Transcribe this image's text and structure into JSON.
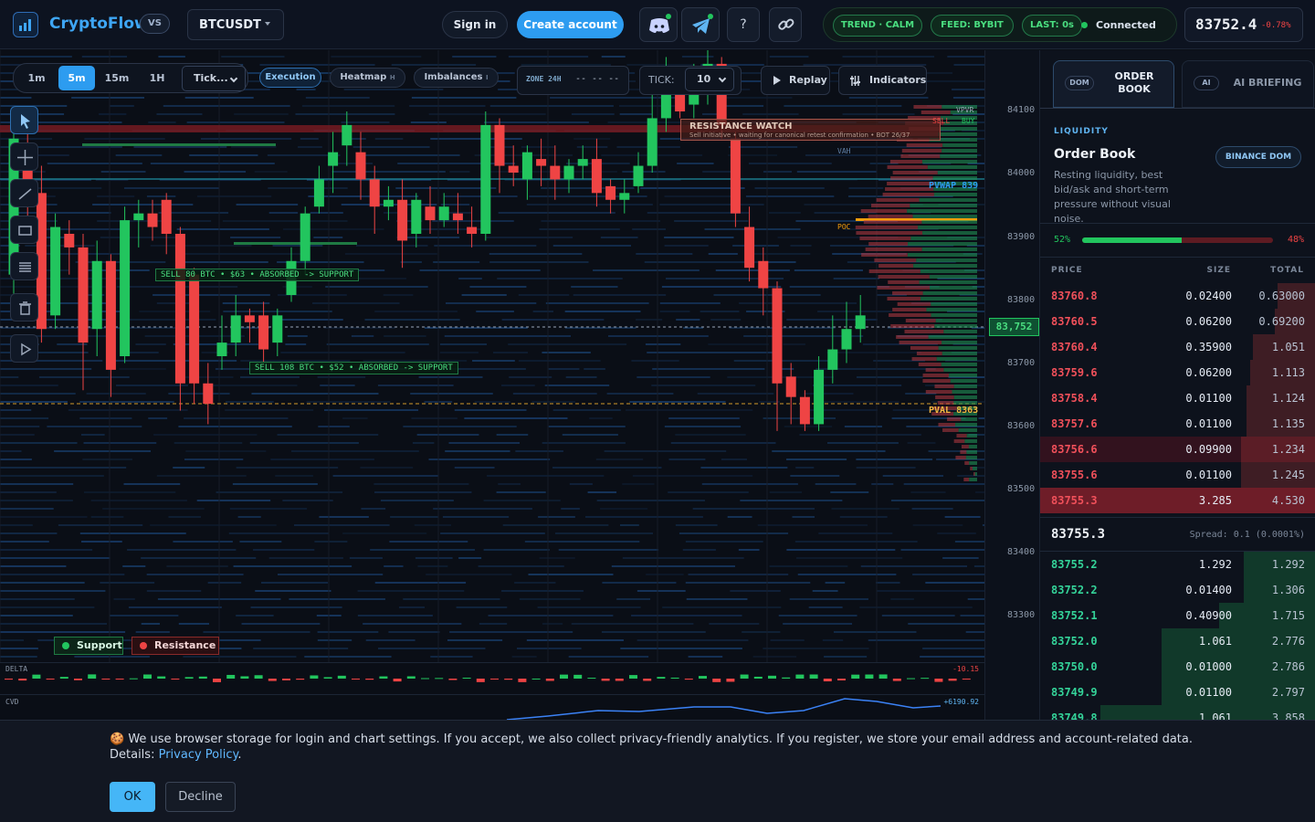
{
  "header": {
    "brand": "CryptoFlow",
    "vs_label": "VS",
    "symbol": "BTCUSDT",
    "sign_in": "Sign in",
    "create_account": "Create account",
    "help_label": "?",
    "status": {
      "trend": "TREND · CALM",
      "feed": "FEED: BYBIT",
      "last": "LAST: 0s",
      "connection": "Connected"
    },
    "price": "83752.4",
    "change": "-0.78%",
    "icons": [
      "discord-icon",
      "telegram-icon",
      "help-icon",
      "link-icon"
    ]
  },
  "toolbar": {
    "timeframes": [
      "1m",
      "5m",
      "15m",
      "1H"
    ],
    "active_timeframe": "5m",
    "type_select": "Tick...",
    "chips": {
      "execution": "Execution",
      "heatmap": "Heatmap",
      "heatmap_key": "H",
      "imbalances": "Imbalances",
      "imbalances_key": "I"
    },
    "zone": {
      "label": "ZONE 24H",
      "value": "-- -- --"
    },
    "tick": {
      "label": "TICK:",
      "value": "10"
    },
    "replay": "Replay",
    "indicators": "Indicators"
  },
  "chart": {
    "resistance_title": "RESISTANCE WATCH",
    "resistance_sub": "Sell initiative • waiting for canonical retest confirmation • BOT 26/37",
    "labels": {
      "absorb1": "SELL 80 BTC • $63 • ABSORBED -> SUPPORT",
      "absorb2": "SELL 108 BTC • $52 • ABSORBED -> SUPPORT",
      "vpvr": "VPVR",
      "sell": "SELL",
      "buy": "BUY",
      "vah": "VAH",
      "pvwap": "PVWAP 839",
      "poc": "POC",
      "pval": "PVAL 8363"
    },
    "legend": {
      "support": "Support",
      "resistance": "Resistance"
    },
    "axis_ticks": [
      "84100",
      "84000",
      "83900",
      "83800",
      "83700",
      "83600",
      "83500",
      "83400",
      "83300"
    ],
    "current_price_tag": "83,752",
    "delta_label": "DELTA",
    "delta_value": "-10.15",
    "cvd_label": "CVD",
    "cvd_value": "+6190.92",
    "colors": {
      "up": "#22c55e",
      "down": "#ef4444",
      "accent": "#2d9cf0"
    }
  },
  "chart_data": {
    "type": "candlestick",
    "ylim": [
      83250,
      84150
    ],
    "candles": [
      [
        83820,
        84020,
        84040,
        83780
      ],
      [
        84010,
        83950,
        84060,
        83900
      ],
      [
        83940,
        83740,
        83980,
        83720
      ],
      [
        83760,
        83890,
        83910,
        83740
      ],
      [
        83880,
        83860,
        83900,
        83820
      ],
      [
        83860,
        83720,
        83880,
        83650
      ],
      [
        83740,
        83840,
        83870,
        83700
      ],
      [
        83840,
        83680,
        83850,
        83640
      ],
      [
        83700,
        83900,
        83920,
        83690
      ],
      [
        83900,
        83910,
        83930,
        83860
      ],
      [
        83910,
        83890,
        83930,
        83870
      ],
      [
        83930,
        83880,
        83940,
        83850
      ],
      [
        83880,
        83660,
        83890,
        83620
      ],
      [
        83820,
        83660,
        83830,
        83630
      ],
      [
        83660,
        83630,
        83690,
        83600
      ],
      [
        83700,
        83720,
        83760,
        83680
      ],
      [
        83720,
        83760,
        83790,
        83700
      ],
      [
        83760,
        83750,
        83770,
        83720
      ],
      [
        83760,
        83710,
        83780,
        83690
      ],
      [
        83720,
        83760,
        83770,
        83700
      ],
      [
        83790,
        83840,
        83860,
        83780
      ],
      [
        83840,
        83910,
        83920,
        83820
      ],
      [
        83920,
        83960,
        83980,
        83910
      ],
      [
        83980,
        84000,
        84030,
        83940
      ],
      [
        84010,
        84040,
        84060,
        83980
      ],
      [
        84000,
        83960,
        84030,
        83930
      ],
      [
        83960,
        83920,
        83980,
        83880
      ],
      [
        83920,
        83930,
        83950,
        83900
      ],
      [
        83930,
        83870,
        83960,
        83830
      ],
      [
        83880,
        83930,
        83940,
        83860
      ],
      [
        83920,
        83900,
        83950,
        83880
      ],
      [
        83900,
        83920,
        83940,
        83890
      ],
      [
        83910,
        83900,
        83940,
        83880
      ],
      [
        83890,
        83880,
        83920,
        83860
      ],
      [
        83880,
        84040,
        84060,
        83870
      ],
      [
        84040,
        83980,
        84050,
        83940
      ],
      [
        83980,
        83970,
        84010,
        83950
      ],
      [
        83960,
        84000,
        84010,
        83930
      ],
      [
        83990,
        83980,
        84020,
        83950
      ],
      [
        83980,
        83960,
        84010,
        83930
      ],
      [
        83960,
        83980,
        83990,
        83940
      ],
      [
        83980,
        83990,
        84010,
        83960
      ],
      [
        83990,
        83940,
        84020,
        83920
      ],
      [
        83950,
        83930,
        83960,
        83910
      ],
      [
        83930,
        83940,
        83960,
        83910
      ],
      [
        83950,
        83980,
        84000,
        83940
      ],
      [
        83980,
        84050,
        84100,
        83970
      ],
      [
        84050,
        84120,
        84140,
        84030
      ],
      [
        84090,
        84060,
        84120,
        84050
      ],
      [
        84070,
        84100,
        84130,
        84050
      ],
      [
        84100,
        84130,
        84150,
        84070
      ],
      [
        84130,
        84040,
        84140,
        84020
      ],
      [
        84020,
        83910,
        84030,
        83890
      ],
      [
        83890,
        83830,
        83920,
        83810
      ],
      [
        83840,
        83800,
        83860,
        83760
      ],
      [
        83800,
        83660,
        83810,
        83590
      ],
      [
        83670,
        83640,
        83690,
        83600
      ],
      [
        83640,
        83600,
        83650,
        83590
      ],
      [
        83600,
        83680,
        83700,
        83590
      ],
      [
        83680,
        83710,
        83760,
        83660
      ],
      [
        83710,
        83740,
        83780,
        83690
      ],
      [
        83740,
        83760,
        83790,
        83720
      ]
    ]
  },
  "order_book": {
    "tab_dom_tag": "DOM",
    "tab_dom": "ORDER BOOK",
    "tab_ai_tag": "AI",
    "tab_ai": "AI BRIEFING",
    "section": "LIQUIDITY",
    "title": "Order Book",
    "description": "Resting liquidity, best bid/ask and short-term pressure without visual noise.",
    "source_button": "BINANCE DOM",
    "bid_pct": "52%",
    "ask_pct": "48%",
    "bid_fraction": 0.52,
    "columns": [
      "PRICE",
      "SIZE",
      "TOTAL"
    ],
    "asks": [
      {
        "price": "83760.8",
        "size": "0.02400",
        "total": "0.63000",
        "depth": 0.14
      },
      {
        "price": "83760.5",
        "size": "0.06200",
        "total": "0.69200",
        "depth": 0.15
      },
      {
        "price": "83760.4",
        "size": "0.35900",
        "total": "1.051",
        "depth": 0.23
      },
      {
        "price": "83759.6",
        "size": "0.06200",
        "total": "1.113",
        "depth": 0.24
      },
      {
        "price": "83758.4",
        "size": "0.01100",
        "total": "1.124",
        "depth": 0.25
      },
      {
        "price": "83757.6",
        "size": "0.01100",
        "total": "1.135",
        "depth": 0.25
      },
      {
        "price": "83756.6",
        "size": "0.09900",
        "total": "1.234",
        "depth": 0.27
      },
      {
        "price": "83755.6",
        "size": "0.01100",
        "total": "1.245",
        "depth": 0.27
      },
      {
        "price": "83755.3",
        "size": "3.285",
        "total": "4.530",
        "depth": 1.0
      }
    ],
    "mid_price": "83755.3",
    "spread": "Spread: 0.1 (0.0001%)",
    "bids": [
      {
        "price": "83755.2",
        "size": "1.292",
        "total": "1.292",
        "depth": 0.26
      },
      {
        "price": "83752.2",
        "size": "0.01400",
        "total": "1.306",
        "depth": 0.26
      },
      {
        "price": "83752.1",
        "size": "0.40900",
        "total": "1.715",
        "depth": 0.35
      },
      {
        "price": "83752.0",
        "size": "1.061",
        "total": "2.776",
        "depth": 0.56
      },
      {
        "price": "83750.0",
        "size": "0.01000",
        "total": "2.786",
        "depth": 0.56
      },
      {
        "price": "83749.9",
        "size": "0.01100",
        "total": "2.797",
        "depth": 0.56
      },
      {
        "price": "83749.8",
        "size": "1.061",
        "total": "3.858",
        "depth": 0.78
      }
    ]
  },
  "cookie": {
    "text": "🍪 We use browser storage for login and chart settings. If you accept, we also collect privacy-friendly analytics. If you register, we store your email address and account-related data. Details:",
    "link": "Privacy Policy",
    "ok": "OK",
    "decline": "Decline"
  }
}
